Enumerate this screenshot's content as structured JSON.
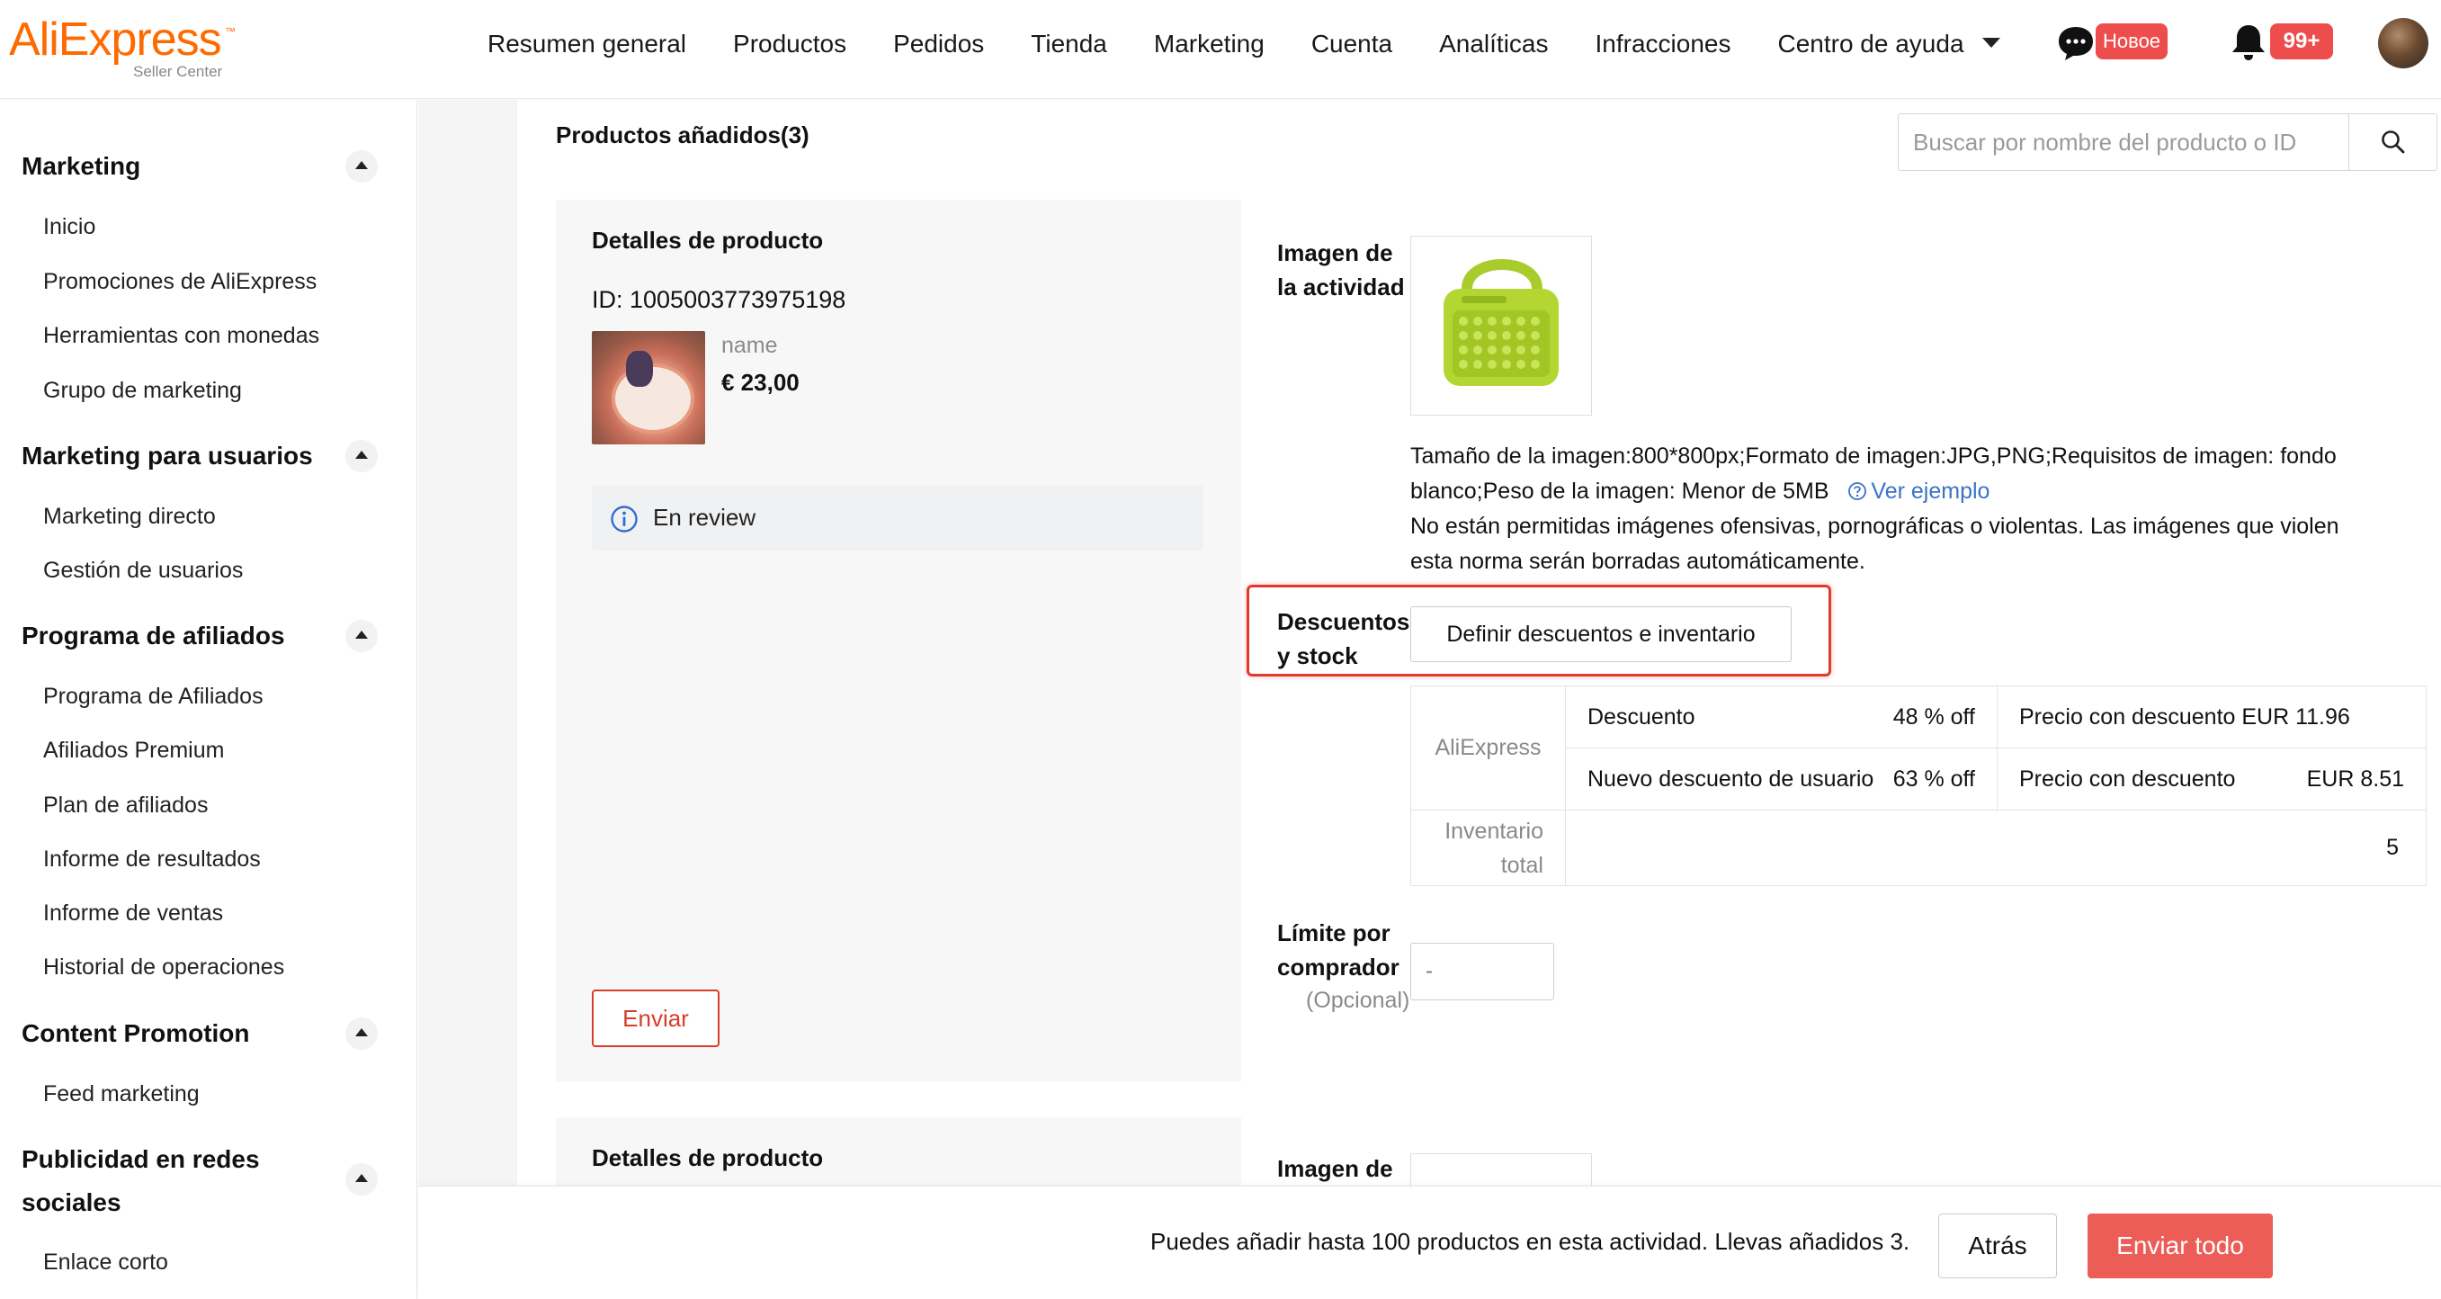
{
  "header": {
    "logo_text": "AliExpress",
    "logo_sub": "Seller Center",
    "nav": [
      "Resumen general",
      "Productos",
      "Pedidos",
      "Tienda",
      "Marketing",
      "Cuenta",
      "Analíticas",
      "Infracciones",
      "Centro de ayuda"
    ],
    "chat_badge": "Новое",
    "notif_badge": "99+",
    "icons": {
      "chat": "chat-bubble-icon",
      "bell": "bell-icon",
      "dropdown": "chevron-down-icon"
    }
  },
  "sidebar": {
    "sections": [
      {
        "title": "Marketing",
        "items": [
          "Inicio",
          "Promociones de AliExpress",
          "Herramientas con monedas",
          "Grupo de marketing"
        ]
      },
      {
        "title": "Marketing para usuarios",
        "items": [
          "Marketing directo",
          "Gestión de usuarios"
        ]
      },
      {
        "title": "Programa de afiliados",
        "items": [
          "Programa de Afiliados",
          "Afiliados Premium",
          "Plan de afiliados",
          "Informe de resultados",
          "Informe de ventas",
          "Historial de operaciones"
        ]
      },
      {
        "title": "Content Promotion",
        "items": [
          "Feed marketing"
        ]
      },
      {
        "title_line1": "Publicidad en redes",
        "title_line2": "sociales",
        "items": [
          "Enlace corto"
        ]
      }
    ]
  },
  "main": {
    "title": "Productos añadidos(3)",
    "search_placeholder": "Buscar por nombre del producto o ID",
    "card": {
      "details_title": "Detalles de producto",
      "product_id": "ID: 1005003773975198",
      "product_name": "name",
      "product_price": "€ 23,00",
      "status": "En review",
      "submit_label": "Enviar",
      "image_label_1": "Imagen de",
      "image_label_2": "la actividad",
      "help_line1": "Tamaño de la imagen:800*800px;Formato de imagen:JPG,PNG;Requisitos de imagen: fondo",
      "help_line2": "blanco;Peso de la imagen: Menor de 5MB",
      "help_link": "Ver ejemplo",
      "help_line3": "No están permitidas imágenes ofensivas, pornográficas o violentas. Las imágenes que violen",
      "help_line4": "esta norma serán borradas automáticamente.",
      "discount_label_1": "Descuentos",
      "discount_label_2": "y stock",
      "define_button": "Definir descuentos e inventario",
      "table": {
        "platform": "AliExpress",
        "row1_label": "Descuento",
        "row1_value": "48 % off",
        "row1_price": "Precio con descuento EUR 11.96",
        "row2_label": "Nuevo descuento de usuario",
        "row2_value": "63 % off",
        "row2_price_label": "Precio con descuento",
        "row2_price_value": "EUR 8.51",
        "inventory_label_1": "Inventario",
        "inventory_label_2": "total",
        "inventory_value": "5"
      },
      "limit_label_1": "Límite por",
      "limit_label_2": "comprador",
      "limit_optional": "(Opcional)",
      "limit_placeholder": "-"
    },
    "card2": {
      "details_title": "Detalles de producto",
      "image_label_1": "Imagen de"
    }
  },
  "footer": {
    "text": "Puedes añadir hasta 100 productos en esta actividad. Llevas añadidos 3.",
    "back": "Atrás",
    "submit_all": "Enviar todo"
  },
  "colors": {
    "brand": "#ff6a00",
    "accent_red": "#d83d2b",
    "primary_button": "#ec5d58",
    "link": "#3b73c6",
    "badge": "#ee4d4d"
  }
}
